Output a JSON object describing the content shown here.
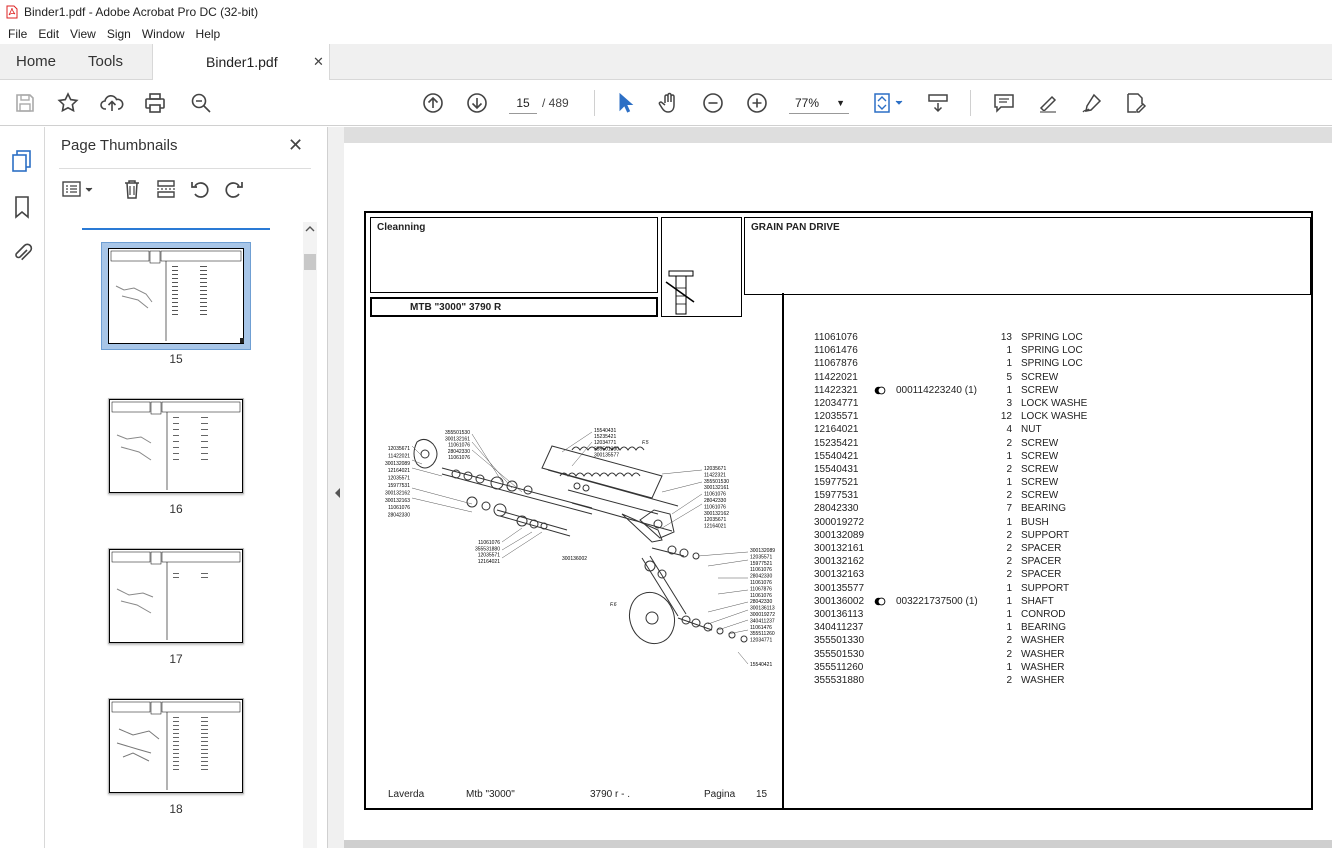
{
  "window": {
    "title": "Binder1.pdf - Adobe Acrobat Pro DC (32-bit)"
  },
  "menu": [
    "File",
    "Edit",
    "View",
    "Sign",
    "Window",
    "Help"
  ],
  "tabs": {
    "home": "Home",
    "tools": "Tools",
    "document": "Binder1.pdf"
  },
  "toolbar": {
    "current_page": "15",
    "page_total": "/ 489",
    "zoom": "77%"
  },
  "sidebar": {
    "title": "Page Thumbnails",
    "thumbnails": [
      {
        "page": "15",
        "selected": true
      },
      {
        "page": "16",
        "selected": false
      },
      {
        "page": "17",
        "selected": false
      },
      {
        "page": "18",
        "selected": false
      }
    ]
  },
  "pdf": {
    "section": "Cleanning",
    "model": "MTB \"3000\" 3790 R",
    "group_title": "GRAIN PAN DRIVE",
    "footer": {
      "brand": "Laverda",
      "model": "Mtb \"3000\"",
      "version": "3790 r - .",
      "page_label": "Pagina",
      "page_number": "15"
    },
    "parts": [
      {
        "code": "11061076",
        "ref": "",
        "qty": "13",
        "desc": "SPRING LOC"
      },
      {
        "code": "11061476",
        "ref": "",
        "qty": "1",
        "desc": "SPRING LOC"
      },
      {
        "code": "11067876",
        "ref": "",
        "qty": "1",
        "desc": "SPRING LOC"
      },
      {
        "code": "11422021",
        "ref": "",
        "qty": "5",
        "desc": "SCREW"
      },
      {
        "code": "11422321",
        "ref": "000114223240  (1)",
        "qty": "1",
        "desc": "SCREW"
      },
      {
        "code": "12034771",
        "ref": "",
        "qty": "3",
        "desc": "LOCK WASHE"
      },
      {
        "code": "12035571",
        "ref": "",
        "qty": "12",
        "desc": "LOCK WASHE"
      },
      {
        "code": "12164021",
        "ref": "",
        "qty": "4",
        "desc": "NUT"
      },
      {
        "code": "15235421",
        "ref": "",
        "qty": "2",
        "desc": "SCREW"
      },
      {
        "code": "15540421",
        "ref": "",
        "qty": "1",
        "desc": "SCREW"
      },
      {
        "code": "15540431",
        "ref": "",
        "qty": "2",
        "desc": "SCREW"
      },
      {
        "code": "15977521",
        "ref": "",
        "qty": "1",
        "desc": "SCREW"
      },
      {
        "code": "15977531",
        "ref": "",
        "qty": "2",
        "desc": "SCREW"
      },
      {
        "code": "28042330",
        "ref": "",
        "qty": "7",
        "desc": "BEARING"
      },
      {
        "code": "300019272",
        "ref": "",
        "qty": "1",
        "desc": "BUSH"
      },
      {
        "code": "300132089",
        "ref": "",
        "qty": "2",
        "desc": "SUPPORT"
      },
      {
        "code": "300132161",
        "ref": "",
        "qty": "2",
        "desc": "SPACER"
      },
      {
        "code": "300132162",
        "ref": "",
        "qty": "2",
        "desc": "SPACER"
      },
      {
        "code": "300132163",
        "ref": "",
        "qty": "2",
        "desc": "SPACER"
      },
      {
        "code": "300135577",
        "ref": "",
        "qty": "1",
        "desc": "SUPPORT"
      },
      {
        "code": "300136002",
        "ref": "003221737500  (1)",
        "qty": "1",
        "desc": "SHAFT"
      },
      {
        "code": "300136113",
        "ref": "",
        "qty": "1",
        "desc": "CONROD"
      },
      {
        "code": "340411237",
        "ref": "",
        "qty": "1",
        "desc": "BEARING"
      },
      {
        "code": "355501330",
        "ref": "",
        "qty": "2",
        "desc": "WASHER"
      },
      {
        "code": "355501530",
        "ref": "",
        "qty": "2",
        "desc": "WASHER"
      },
      {
        "code": "355511260",
        "ref": "",
        "qty": "1",
        "desc": "WASHER"
      },
      {
        "code": "355531880",
        "ref": "",
        "qty": "2",
        "desc": "WASHER"
      }
    ],
    "diagram_labels": {
      "left": [
        "12035671",
        "11422021",
        "300132089",
        "12164021",
        "12035571",
        "15977531",
        "300132162",
        "300132163",
        "11061076",
        "28042330"
      ],
      "top_mid": [
        "355501530",
        "300132161",
        "11061076",
        "28042330",
        "11061076"
      ],
      "top_right": [
        "15540431",
        "15235421",
        "12034771",
        "355501330",
        "300135577"
      ],
      "right_upper": [
        "12035671",
        "11422321",
        "355501530",
        "300132161",
        "11061076",
        "28042330",
        "11061076",
        "300132162",
        "12035671",
        "12164021"
      ],
      "right_lower": [
        "300132089",
        "12035571",
        "15977521",
        "11061076",
        "28042330",
        "11061076",
        "11067876",
        "11061076",
        "28042330",
        "300136113",
        "300019272",
        "340411237",
        "11061476",
        "355511260",
        "12034771"
      ],
      "bottom": [
        "15540421"
      ],
      "lower_left": [
        "11061076",
        "355531880",
        "12035571",
        "12164021"
      ],
      "shaft": "300136002",
      "figure_refs": [
        "F.5",
        "F.6"
      ]
    }
  }
}
